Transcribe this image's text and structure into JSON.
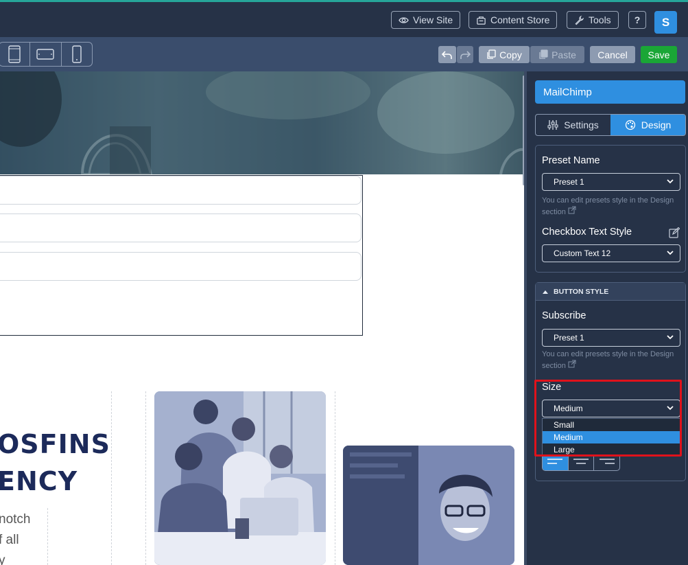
{
  "topbar": {
    "view_site": "View Site",
    "content_store": "Content Store",
    "tools": "Tools",
    "help": "?",
    "avatar_initial": "S",
    "accent_color": "#26a69a"
  },
  "toolbar": {
    "devices": [
      "tablet-portrait",
      "tablet-landscape",
      "mobile"
    ],
    "copy_label": "Copy",
    "paste_label": "Paste",
    "cancel_label": "Cancel",
    "save_label": "Save",
    "save_color": "#1aa636"
  },
  "canvas": {
    "headline_line1": "OSFINS",
    "headline_line2": "ENCY",
    "body_line1": "notch",
    "body_line2": "f all",
    "body_line3": "y"
  },
  "panel": {
    "widget_title": "MailChimp",
    "tabs": [
      {
        "label": "Settings",
        "icon": "sliders-icon",
        "active": false
      },
      {
        "label": "Design",
        "icon": "palette-icon",
        "active": true
      }
    ],
    "preset_section": {
      "preset_name_label": "Preset Name",
      "preset_name_value": "Preset 1",
      "preset_hint": "You can edit presets style in the Design section",
      "checkbox_label": "Checkbox Text Style",
      "checkbox_value": "Custom Text 12"
    },
    "button_style": {
      "header": "BUTTON STYLE",
      "subscribe_label": "Subscribe",
      "subscribe_value": "Preset 1",
      "subscribe_hint": "You can edit presets style in the Design section",
      "size_label": "Size",
      "size_value": "Medium",
      "size_options": [
        "Small",
        "Medium",
        "Large"
      ],
      "alignment": [
        "left",
        "center",
        "right"
      ],
      "active_alignment": "left"
    },
    "accent_color": "#2f8fe0",
    "highlight_color": "#e0121b"
  }
}
